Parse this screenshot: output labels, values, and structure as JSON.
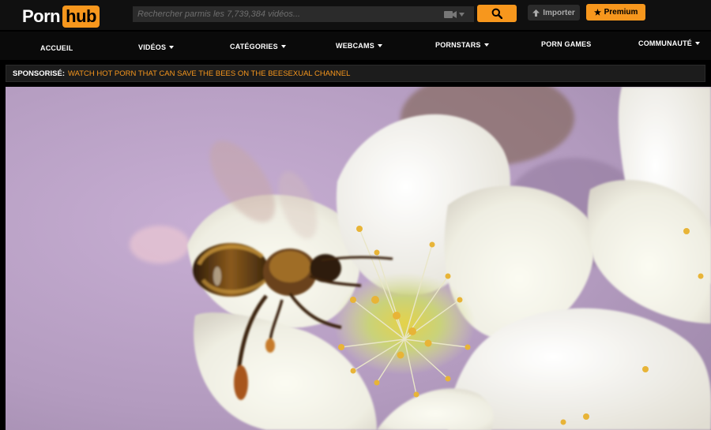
{
  "logo": {
    "word": "Porn",
    "boxed": "hub"
  },
  "search": {
    "placeholder": "Rechercher parmis les 7,739,384 vidéos..."
  },
  "header": {
    "upload_label": "Importer",
    "premium_label": "Premium"
  },
  "nav": {
    "items": [
      {
        "label": "ACCUEIL"
      },
      {
        "label": "VIDÉOS"
      },
      {
        "label": "CATÉGORIES"
      },
      {
        "label": "WEBCAMS"
      },
      {
        "label": "PORNSTARS"
      },
      {
        "label": "PORN GAMES"
      },
      {
        "label": "COMMUNAUTÉ"
      }
    ]
  },
  "sponsor": {
    "label": "SPONSORISÉ:",
    "link": "WATCH HOT PORN THAT CAN SAVE THE BEES ON THE BEESEXUAL CHANNEL"
  },
  "colors": {
    "accent": "#f7971d",
    "header_bg": "#101010",
    "nav_bg": "#0a0a0a"
  },
  "icons": {
    "video_camera": "video-camera-icon",
    "search": "search-icon",
    "upload": "upload-icon",
    "premium": "star-icon"
  }
}
